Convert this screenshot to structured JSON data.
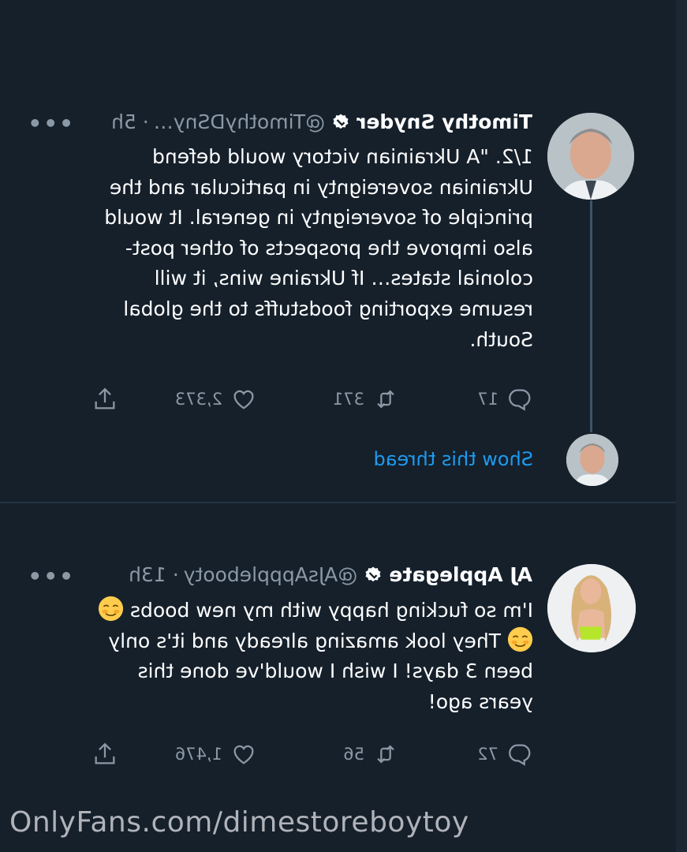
{
  "tweets": [
    {
      "name": "Timothy Snyder",
      "handle": "@TimothyDSny…",
      "time": "· 5h",
      "more": "•••",
      "lines": [
        "1/2. \"A Ukrainian victory would defend",
        "Ukrainian sovereignty in particular and the",
        "principle of sovereignty in general. It would",
        "also improve the prospects of other post-",
        "colonial states… If Ukraine wins, it will",
        "resume exporting foodstuffs to the global",
        "South."
      ],
      "replies": "17",
      "retweets": "371",
      "likes": "2,373",
      "show_thread": "Show this thread"
    },
    {
      "name": "AJ Applegate",
      "handle": "@AJsAppplebooty",
      "time": "· 13h",
      "more": "•••",
      "lines": [
        "I'm so fucking happy with my new boobs",
        "They look amazing already and it's only",
        "been 3 days! I wish I would've done this",
        "years ago!"
      ],
      "replies": "72",
      "retweets": "56",
      "likes": "1,476"
    }
  ],
  "watermark": "OnlyFans.com/dimestoreboytoy",
  "icons": {
    "verified": "verified-badge-icon",
    "reply": "reply-icon",
    "retweet": "retweet-icon",
    "like": "heart-icon",
    "share": "share-icon",
    "emoji": "smiling-face-emoji"
  },
  "colors": {
    "background": "#15202b",
    "link": "#1d9bf0",
    "secondary_text": "#8b98a5"
  }
}
